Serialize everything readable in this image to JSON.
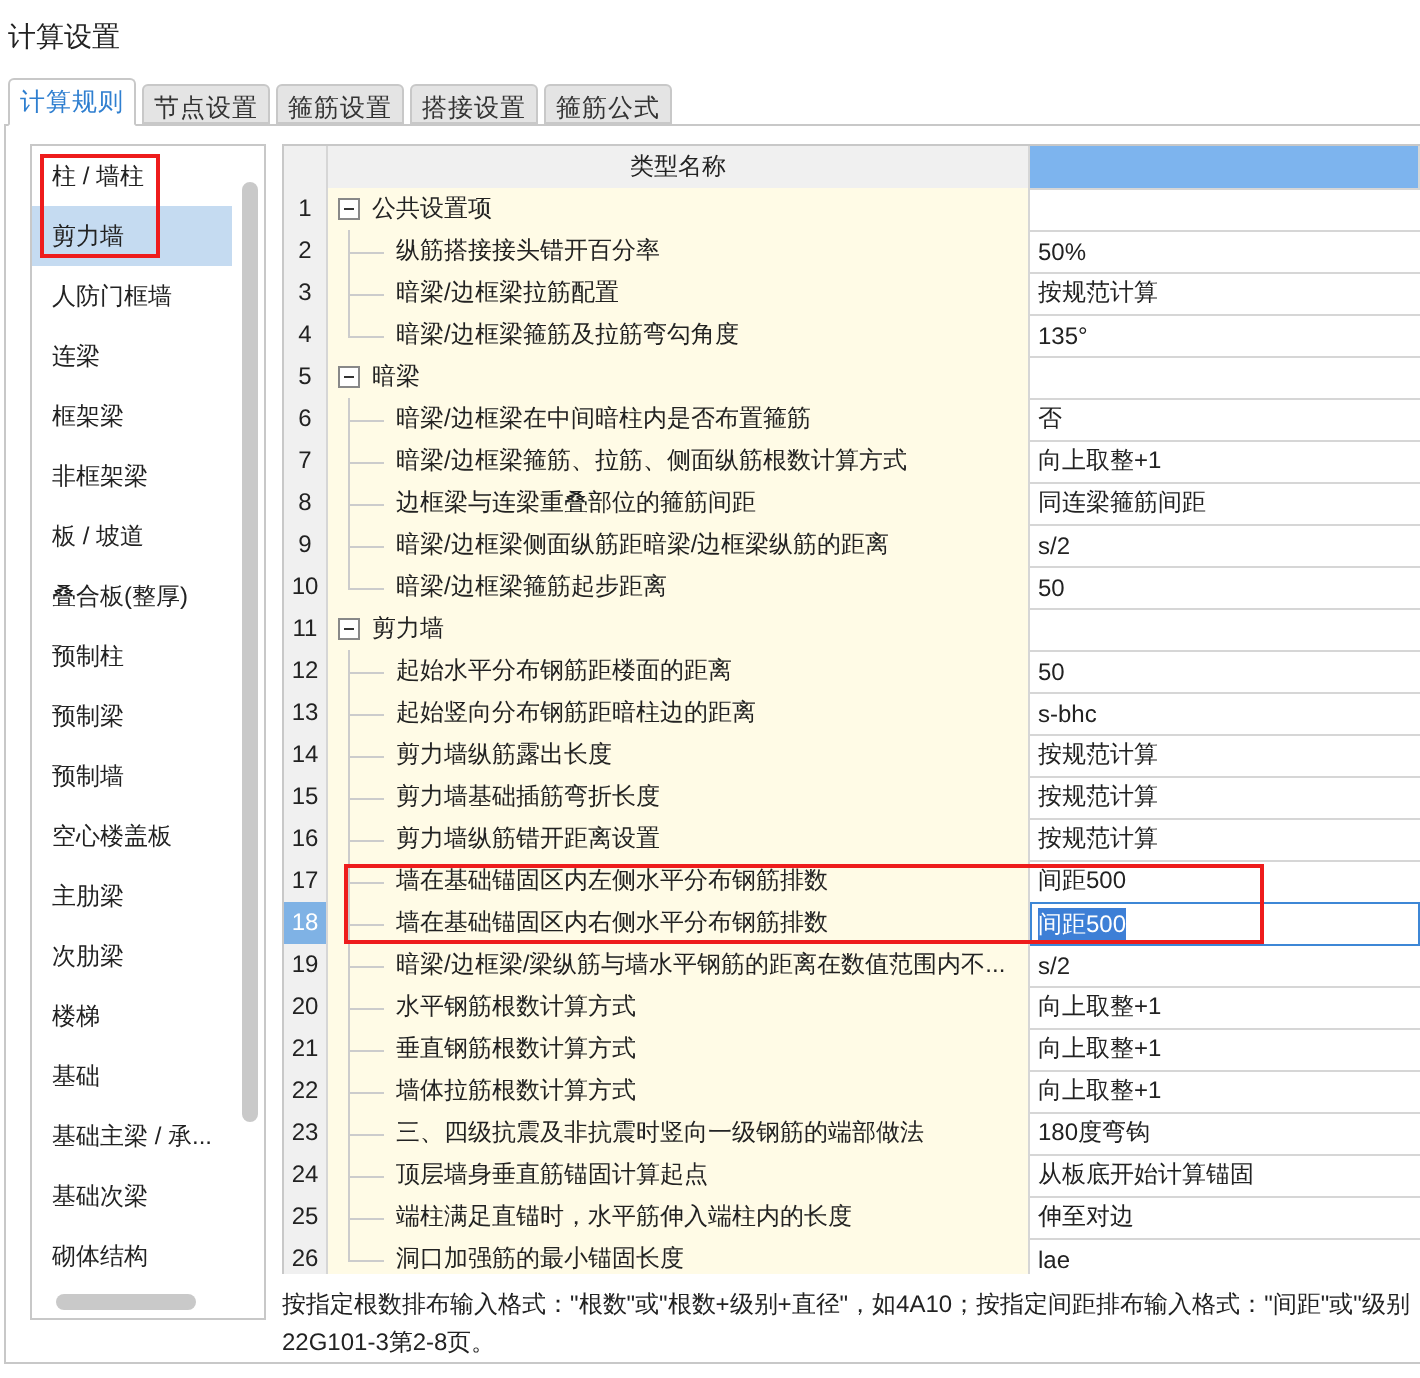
{
  "window": {
    "title": "计算设置"
  },
  "tabs": [
    {
      "label": "计算规则",
      "selected": true
    },
    {
      "label": "节点设置",
      "selected": false
    },
    {
      "label": "箍筋设置",
      "selected": false
    },
    {
      "label": "搭接设置",
      "selected": false
    },
    {
      "label": "箍筋公式",
      "selected": false
    }
  ],
  "sidebar": {
    "items": [
      {
        "label": "柱 / 墙柱",
        "selected": false,
        "marked": true
      },
      {
        "label": "剪力墙",
        "selected": true,
        "marked": true
      },
      {
        "label": "人防门框墙",
        "selected": false,
        "marked": false
      },
      {
        "label": "连梁",
        "selected": false,
        "marked": false
      },
      {
        "label": "框架梁",
        "selected": false,
        "marked": false
      },
      {
        "label": "非框架梁",
        "selected": false,
        "marked": false
      },
      {
        "label": "板 / 坡道",
        "selected": false,
        "marked": false
      },
      {
        "label": "叠合板(整厚)",
        "selected": false,
        "marked": false
      },
      {
        "label": "预制柱",
        "selected": false,
        "marked": false
      },
      {
        "label": "预制梁",
        "selected": false,
        "marked": false
      },
      {
        "label": "预制墙",
        "selected": false,
        "marked": false
      },
      {
        "label": "空心楼盖板",
        "selected": false,
        "marked": false
      },
      {
        "label": "主肋梁",
        "selected": false,
        "marked": false
      },
      {
        "label": "次肋梁",
        "selected": false,
        "marked": false
      },
      {
        "label": "楼梯",
        "selected": false,
        "marked": false
      },
      {
        "label": "基础",
        "selected": false,
        "marked": false
      },
      {
        "label": "基础主梁 / 承...",
        "selected": false,
        "marked": false
      },
      {
        "label": "基础次梁",
        "selected": false,
        "marked": false
      },
      {
        "label": "砌体结构",
        "selected": false,
        "marked": false
      }
    ]
  },
  "table": {
    "columns": [
      {
        "label": "类型名称",
        "selected": false
      },
      {
        "selected": true
      }
    ],
    "rows": [
      {
        "number": "1",
        "label": "公共设置项",
        "expanded": true,
        "children": [
          {
            "number": "2",
            "label": "纵筋搭接接头错开百分率",
            "value": "50%",
            "selected": false,
            "marked": false
          },
          {
            "number": "3",
            "label": "暗梁/边框梁拉筋配置",
            "value": "按规范计算",
            "selected": false,
            "marked": false
          },
          {
            "number": "4",
            "label": "暗梁/边框梁箍筋及拉筋弯勾角度",
            "value": "135°",
            "selected": false,
            "marked": false
          }
        ]
      },
      {
        "number": "5",
        "label": "暗梁",
        "expanded": true,
        "children": [
          {
            "number": "6",
            "label": "暗梁/边框梁在中间暗柱内是否布置箍筋",
            "value": "否",
            "selected": false,
            "marked": false
          },
          {
            "number": "7",
            "label": "暗梁/边框梁箍筋、拉筋、侧面纵筋根数计算方式",
            "value": "向上取整+1",
            "selected": false,
            "marked": false
          },
          {
            "number": "8",
            "label": "边框梁与连梁重叠部位的箍筋间距",
            "value": "同连梁箍筋间距",
            "selected": false,
            "marked": false
          },
          {
            "number": "9",
            "label": "暗梁/边框梁侧面纵筋距暗梁/边框梁纵筋的距离",
            "value": "s/2",
            "selected": false,
            "marked": false
          },
          {
            "number": "10",
            "label": "暗梁/边框梁箍筋起步距离",
            "value": "50",
            "selected": false,
            "marked": false
          }
        ]
      },
      {
        "number": "11",
        "label": "剪力墙",
        "expanded": true,
        "children": [
          {
            "number": "12",
            "label": "起始水平分布钢筋距楼面的距离",
            "value": "50",
            "selected": false,
            "marked": false
          },
          {
            "number": "13",
            "label": "起始竖向分布钢筋距暗柱边的距离",
            "value": "s-bhc",
            "selected": false,
            "marked": false
          },
          {
            "number": "14",
            "label": "剪力墙纵筋露出长度",
            "value": "按规范计算",
            "selected": false,
            "marked": false
          },
          {
            "number": "15",
            "label": "剪力墙基础插筋弯折长度",
            "value": "按规范计算",
            "selected": false,
            "marked": false
          },
          {
            "number": "16",
            "label": "剪力墙纵筋错开距离设置",
            "value": "按规范计算",
            "selected": false,
            "marked": false
          },
          {
            "number": "17",
            "label": "墙在基础锚固区内左侧水平分布钢筋排数",
            "value": "间距500",
            "selected": false,
            "marked": true
          },
          {
            "number": "18",
            "label": "墙在基础锚固区内右侧水平分布钢筋排数",
            "value": "间距500",
            "selected": true,
            "marked": true
          },
          {
            "number": "19",
            "label": "暗梁/边框梁/梁纵筋与墙水平钢筋的距离在数值范围内不...",
            "value": "s/2",
            "selected": false,
            "marked": false
          },
          {
            "number": "20",
            "label": "水平钢筋根数计算方式",
            "value": "向上取整+1",
            "selected": false,
            "marked": false
          },
          {
            "number": "21",
            "label": "垂直钢筋根数计算方式",
            "value": "向上取整+1",
            "selected": false,
            "marked": false
          },
          {
            "number": "22",
            "label": "墙体拉筋根数计算方式",
            "value": "向上取整+1",
            "selected": false,
            "marked": false
          },
          {
            "number": "23",
            "label": "三、四级抗震及非抗震时竖向一级钢筋的端部做法",
            "value": "180度弯钩",
            "selected": false,
            "marked": false
          },
          {
            "number": "24",
            "label": "顶层墙身垂直筋锚固计算起点",
            "value": "从板底开始计算锚固",
            "selected": false,
            "marked": false
          },
          {
            "number": "25",
            "label": "端柱满足直锚时，水平筋伸入端柱内的长度",
            "value": "伸至对边",
            "selected": false,
            "marked": false
          },
          {
            "number": "26",
            "label": "洞口加强筋的最小锚固长度",
            "value": "lae",
            "selected": false,
            "marked": false
          }
        ]
      }
    ]
  },
  "hint": {
    "lines": [
      "按指定根数排布输入格式：\"根数\"或\"根数+级别+直径\"，如4A10；按指定间距排布输入格式：\"间距\"或\"级别",
      "22G101-3第2-8页。"
    ]
  }
}
